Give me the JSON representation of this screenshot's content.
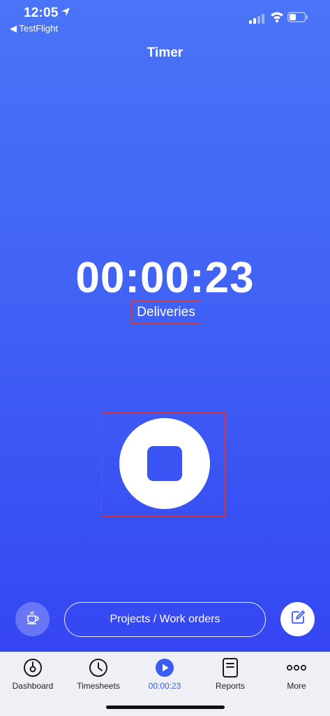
{
  "status_bar": {
    "time": "12:05",
    "back_app": "◀ TestFlight",
    "location_icon": "location-arrow-icon",
    "signal_icon": "cellular-signal-icon",
    "wifi_icon": "wifi-icon",
    "battery_icon": "battery-icon"
  },
  "header": {
    "title": "Timer"
  },
  "timer": {
    "elapsed": "00:00:23",
    "project": "Deliveries",
    "stop_icon": "stop-icon"
  },
  "actions": {
    "break_icon": "coffee-cup-icon",
    "projects_label": "Projects / Work orders",
    "edit_icon": "compose-icon"
  },
  "tabbar": {
    "tabs": [
      {
        "label": "Dashboard",
        "icon": "gauge-icon"
      },
      {
        "label": "Timesheets",
        "icon": "clock-icon"
      },
      {
        "label": "00:00:23",
        "icon": "play-icon",
        "active": true
      },
      {
        "label": "Reports",
        "icon": "report-icon"
      },
      {
        "label": "More",
        "icon": "more-dots-icon"
      }
    ]
  },
  "colors": {
    "background_top": "#4a74f7",
    "background_bottom": "#3546f2",
    "accent": "#3a5cf3",
    "highlight_box": "#d9363e"
  }
}
